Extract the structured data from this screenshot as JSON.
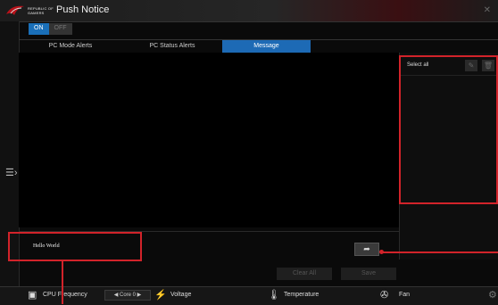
{
  "app": {
    "brand_line1": "REPUBLIC OF",
    "brand_line2": "GAMERS",
    "title": "Push Notice",
    "close_glyph": "✕"
  },
  "toggle": {
    "on_label": "ON",
    "off_label": "OFF"
  },
  "tabs": [
    {
      "label": "PC Mode Alerts"
    },
    {
      "label": "PC Status Alerts"
    },
    {
      "label": "Message"
    }
  ],
  "right_panel": {
    "select_all_label": "Select all",
    "edit_icon": "edit-icon",
    "delete_icon": "trash-icon"
  },
  "message": {
    "text": "Hello World"
  },
  "actions": {
    "clear_all": "Clear All",
    "save": "Save"
  },
  "bottom_bar": {
    "cpu_frequency": "CPU Frequency",
    "core_selected": "Core 0",
    "voltage": "Voltage",
    "temperature": "Temperature",
    "fan": "Fan"
  },
  "colors": {
    "accent": "#1d6ab5",
    "highlight": "#d2232a"
  }
}
